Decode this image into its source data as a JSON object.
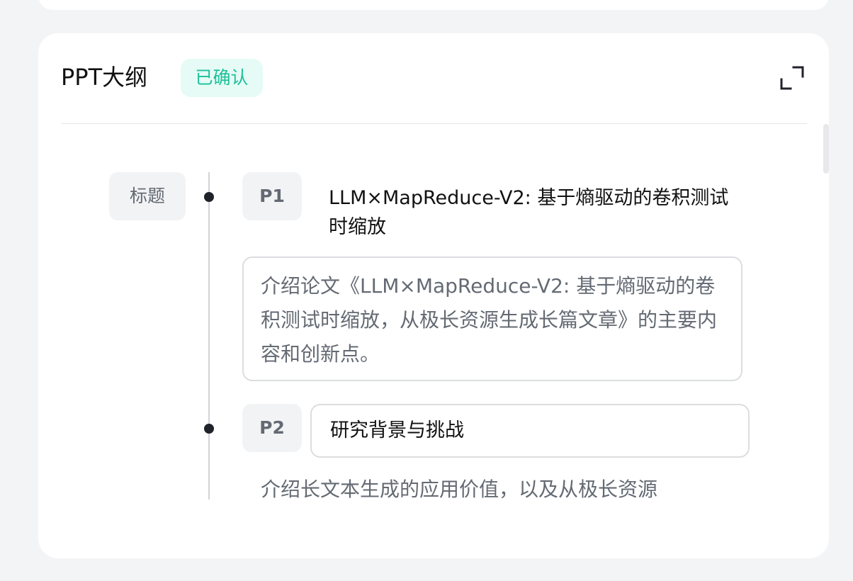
{
  "outline": {
    "title": "PPT大纲",
    "status_badge": "已确认",
    "expand_icon": "expand-icon",
    "title_tag": "标题",
    "pages": [
      {
        "label": "P1",
        "title": "LLM×MapReduce-V2: 基于熵驱动的卷积测试时缩放",
        "description": "介绍论文《LLM×MapReduce-V2: 基于熵驱动的卷积测试时缩放，从极长资源生成长篇文章》的主要内容和创新点。"
      },
      {
        "label": "P2",
        "title": "研究背景与挑战",
        "description": "介绍长文本生成的应用价值，以及从极长资源"
      }
    ]
  },
  "colors": {
    "accent": "#1cc09a",
    "badge_bg": "#e6fbf5"
  }
}
